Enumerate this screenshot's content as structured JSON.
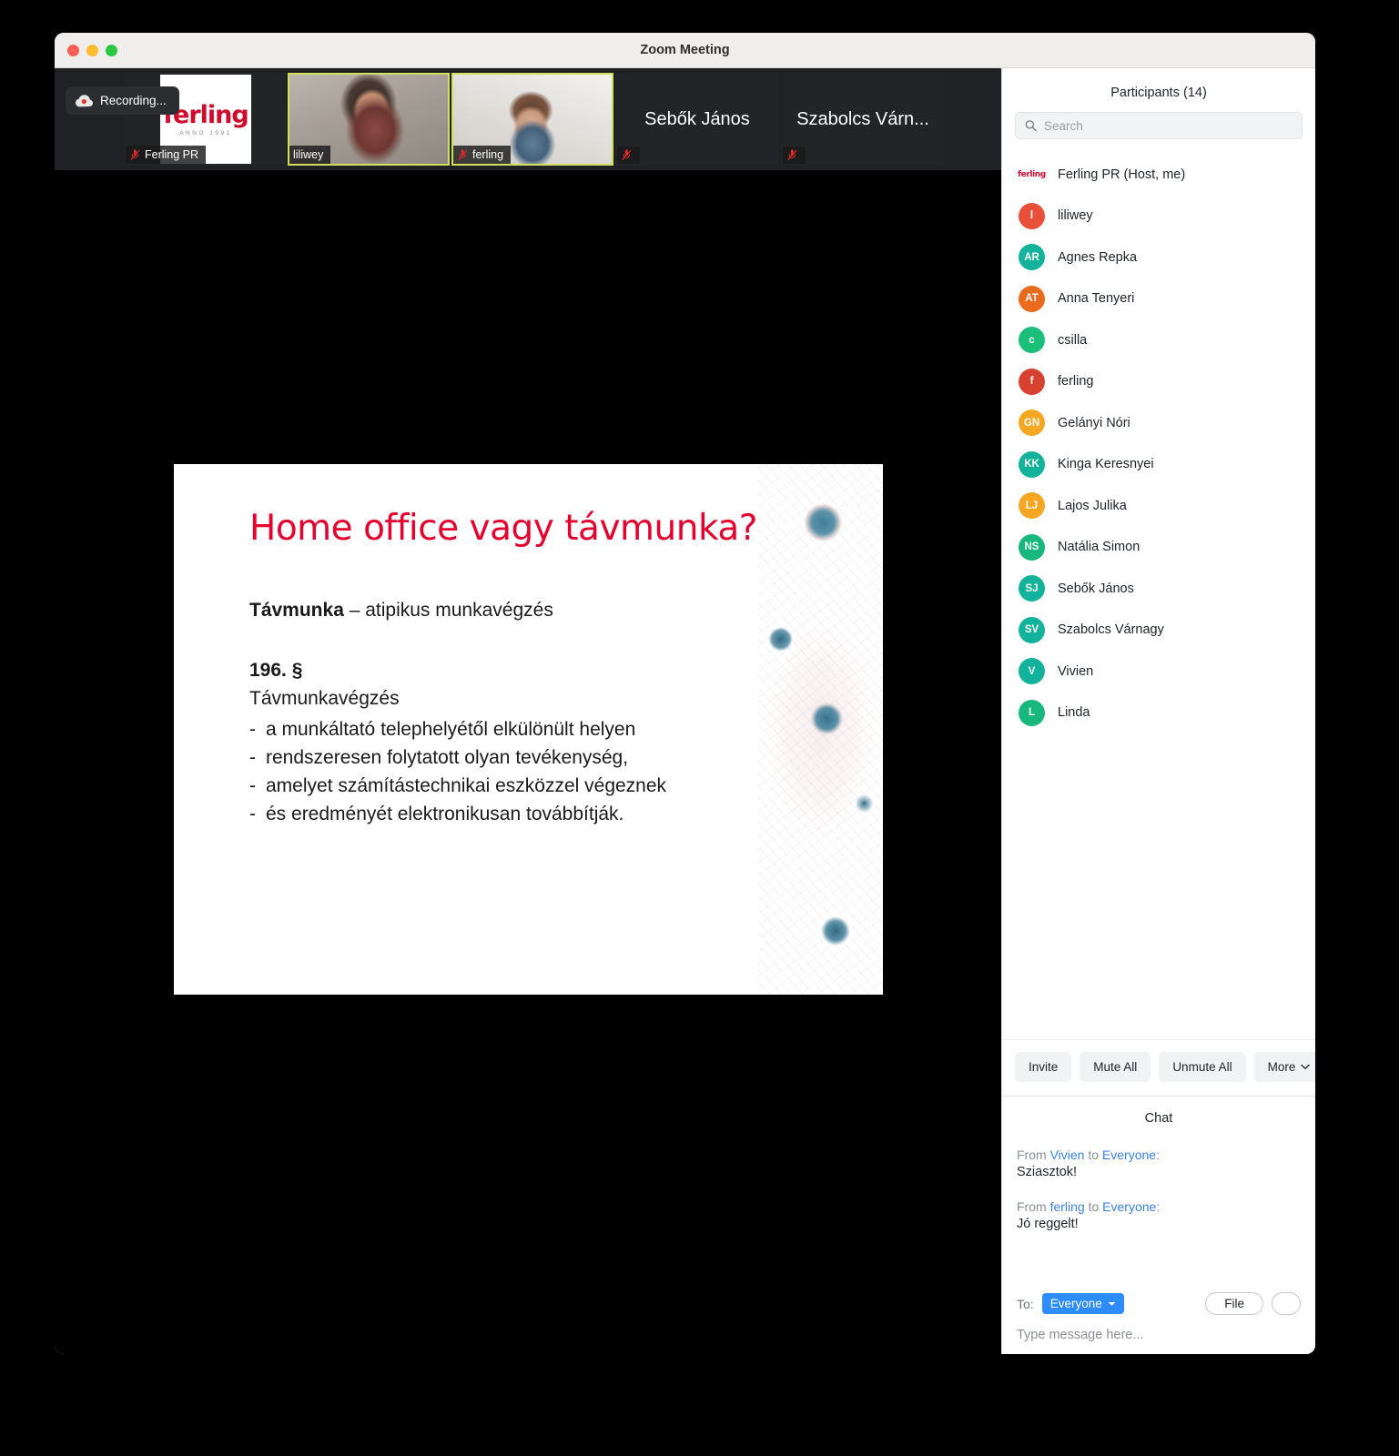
{
  "window": {
    "title": "Zoom Meeting",
    "traffic_lights": [
      "close",
      "minimize",
      "maximize"
    ]
  },
  "stage": {
    "recording_label": "Recording...",
    "filmstrip": [
      {
        "name": "Ferling PR",
        "kind": "logo",
        "muted": true,
        "active": false,
        "name_position": "bottom-left"
      },
      {
        "name": "liliwey",
        "kind": "video",
        "muted": false,
        "active": true,
        "name_position": "bottom-left"
      },
      {
        "name": "ferling",
        "kind": "video",
        "muted": true,
        "active": true,
        "name_position": "bottom-left"
      },
      {
        "name": "Sebők János",
        "kind": "placeholder",
        "muted": true,
        "active": false,
        "name_position": "center"
      },
      {
        "name": "Szabolcs Várn...",
        "kind": "placeholder",
        "muted": true,
        "active": false,
        "name_position": "center"
      }
    ],
    "logo": {
      "word": "ferling",
      "sub": "ANNO 1991"
    }
  },
  "slide": {
    "title": "Home office vagy távmunka?",
    "lead_bold": "Távmunka",
    "lead_rest": " – atipikus munkavégzés",
    "section": "196. §",
    "subsection": "Távmunkavégzés",
    "bullets": [
      "a munkáltató telephelyétől elkülönült helyen",
      "rendszeresen folytatott olyan tevékenység,",
      "amelyet számítástechnikai eszközzel végeznek",
      "és eredményét elektronikusan továbbítják."
    ],
    "bullet_dash": "-"
  },
  "participants_panel": {
    "title": "Participants (14)",
    "search_placeholder": "Search",
    "search_value": "",
    "items": [
      {
        "name": "Ferling PR (Host, me)",
        "initials": "ferling",
        "color": "#ffffff",
        "is_logo": true
      },
      {
        "name": "liliwey",
        "initials": "l",
        "color": "#e8503a",
        "is_logo": false
      },
      {
        "name": "Agnes Repka",
        "initials": "AR",
        "color": "#13b29a",
        "is_logo": false
      },
      {
        "name": "Anna Tenyeri",
        "initials": "AT",
        "color": "#ea6a1e",
        "is_logo": false
      },
      {
        "name": "csilla",
        "initials": "c",
        "color": "#1bbf7a",
        "is_logo": false
      },
      {
        "name": "ferling",
        "initials": "f",
        "color": "#d8402f",
        "is_logo": false
      },
      {
        "name": "Gelányi Nóri",
        "initials": "GN",
        "color": "#f5a623",
        "is_logo": false
      },
      {
        "name": "Kinga Keresnyei",
        "initials": "KK",
        "color": "#13b29a",
        "is_logo": false
      },
      {
        "name": "Lajos Julika",
        "initials": "LJ",
        "color": "#f5a623",
        "is_logo": false
      },
      {
        "name": "Natália Simon",
        "initials": "NS",
        "color": "#18b77e",
        "is_logo": false
      },
      {
        "name": "Sebők János",
        "initials": "SJ",
        "color": "#13b29a",
        "is_logo": false
      },
      {
        "name": "Szabolcs Várnagy",
        "initials": "SV",
        "color": "#13b29a",
        "is_logo": false
      },
      {
        "name": "Vivien",
        "initials": "V",
        "color": "#13b29a",
        "is_logo": false
      },
      {
        "name": "Linda",
        "initials": "L",
        "color": "#18b77e",
        "is_logo": false
      }
    ],
    "actions": {
      "invite": "Invite",
      "mute_all": "Mute All",
      "unmute_all": "Unmute All",
      "more": "More"
    }
  },
  "chat": {
    "title": "Chat",
    "messages": [
      {
        "from": "Vivien",
        "to": "Everyone",
        "prefix": "From",
        "mid": "to",
        "suffix": ":",
        "text": "Sziasztok!"
      },
      {
        "from": "ferling",
        "to": "Everyone",
        "prefix": "From",
        "mid": "to",
        "suffix": ":",
        "text": "Jó reggelt!"
      }
    ],
    "to_label": "To:",
    "to_value": "Everyone",
    "file_button": "File",
    "emoji_button": "",
    "input_placeholder": "Type message here...",
    "input_value": ""
  },
  "colors": {
    "accent_blue": "#2d8cff",
    "brand_red": "#cf0a2c",
    "slide_title_red": "#e4032e",
    "active_tile": "#cfe05a",
    "panel_bg": "#ffffff",
    "stage_bg": "#000000"
  }
}
